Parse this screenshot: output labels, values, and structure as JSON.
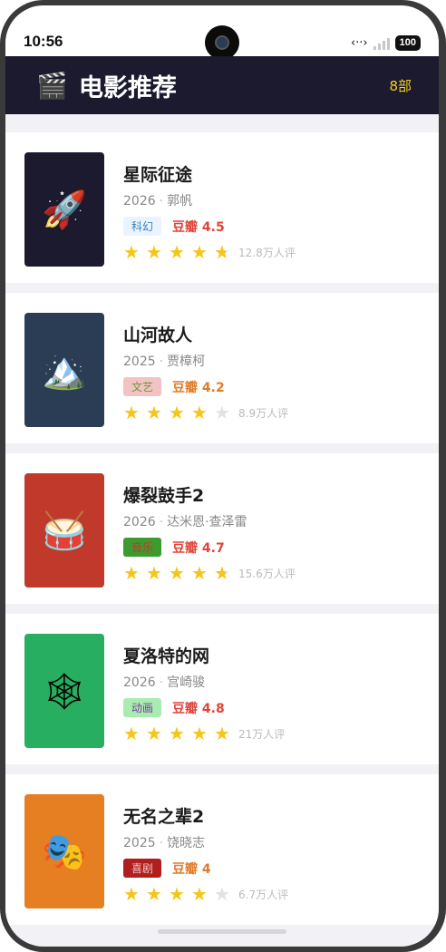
{
  "status": {
    "time": "10:56",
    "battery": "100"
  },
  "header": {
    "icon": "🎬",
    "title": "电影推荐",
    "count": "8部"
  },
  "movies": [
    {
      "title": "星际征途",
      "year": "2026",
      "director": "郭帆",
      "genre": "科幻",
      "score": "豆瓣 4.5",
      "reviews": "12.8万人评",
      "poster_icon": "🚀",
      "poster_bg": "#1b1a2e",
      "genre_bg": "#eaf4ff",
      "genre_color": "#3b82c4",
      "score_color": "#e0443a",
      "stars": [
        "full",
        "full",
        "full",
        "full",
        "half"
      ]
    },
    {
      "title": "山河故人",
      "year": "2025",
      "director": "贾樟柯",
      "genre": "文艺",
      "score": "豆瓣 4.2",
      "reviews": "8.9万人评",
      "poster_icon": "🏔️",
      "poster_bg": "#2b3d55",
      "genre_bg": "#f3c3c3",
      "genre_color": "#6a9a3c",
      "score_color": "#e07b2a",
      "stars": [
        "full",
        "full",
        "full",
        "full",
        "empty"
      ]
    },
    {
      "title": "爆裂鼓手2",
      "year": "2026",
      "director": "达米恩·查泽雷",
      "genre": "音乐",
      "score": "豆瓣 4.7",
      "reviews": "15.6万人评",
      "poster_icon": "🥁",
      "poster_bg": "#c0392b",
      "genre_bg": "#3d9a2e",
      "genre_color": "#c0392b",
      "score_color": "#e0443a",
      "stars": [
        "full",
        "full",
        "full",
        "full",
        "half"
      ]
    },
    {
      "title": "夏洛特的网",
      "year": "2026",
      "director": "宫崎骏",
      "genre": "动画",
      "score": "豆瓣 4.8",
      "reviews": "21万人评",
      "poster_icon": "🕸",
      "poster_bg": "#27ae60",
      "genre_bg": "#a9ecb0",
      "genre_color": "#7a3aa0",
      "score_color": "#e0443a",
      "stars": [
        "full",
        "full",
        "full",
        "full",
        "full"
      ]
    },
    {
      "title": "无名之辈2",
      "year": "2025",
      "director": "饶晓志",
      "genre": "喜剧",
      "score": "豆瓣 4",
      "reviews": "6.7万人评",
      "poster_icon": "🎭",
      "poster_bg": "#e67e22",
      "genre_bg": "#b11e1e",
      "genre_color": "#f3c3c3",
      "score_color": "#e07b2a",
      "stars": [
        "full",
        "full",
        "full",
        "full",
        "empty"
      ]
    }
  ]
}
